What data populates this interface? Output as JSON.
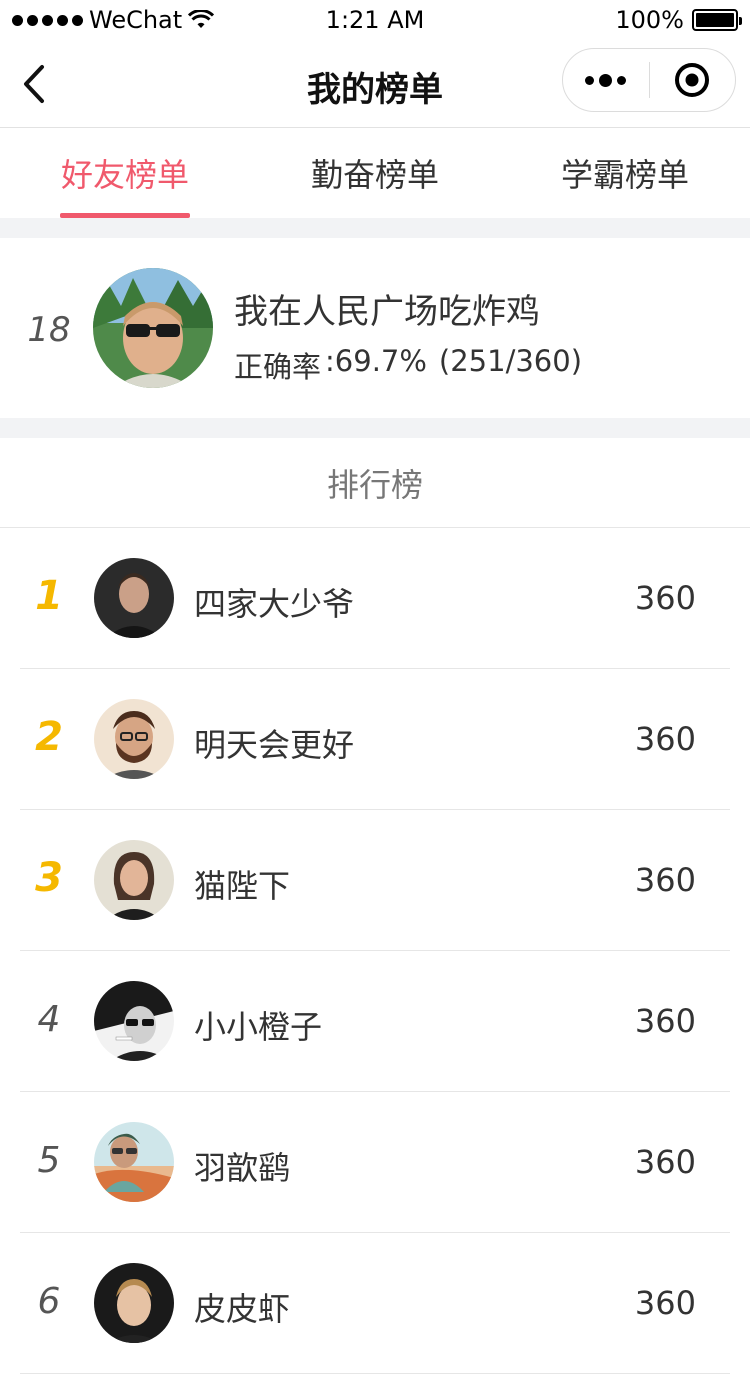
{
  "status_bar": {
    "carrier": "WeChat",
    "time": "1:21 AM",
    "battery": "100%",
    "battery_level": 1.0
  },
  "nav": {
    "title": "我的榜单"
  },
  "tabs": [
    {
      "label": "好友榜单",
      "active": true
    },
    {
      "label": "勤奋榜单",
      "active": false
    },
    {
      "label": "学霸榜单",
      "active": false
    }
  ],
  "my_card": {
    "rank": "18",
    "name": "我在人民广场吃炸鸡",
    "accuracy_label": "正确率",
    "accuracy_value": ":69.7%",
    "accuracy_ratio": "(251/360)"
  },
  "board": {
    "header": "排行榜",
    "rows": [
      {
        "rank": "1",
        "name": "四家大少爷",
        "score": "360"
      },
      {
        "rank": "2",
        "name": "明天会更好",
        "score": "360"
      },
      {
        "rank": "3",
        "name": "猫陛下",
        "score": "360"
      },
      {
        "rank": "4",
        "name": "小小橙子",
        "score": "360"
      },
      {
        "rank": "5",
        "name": "羽歆鹞",
        "score": "360"
      },
      {
        "rank": "6",
        "name": "皮皮虾",
        "score": "360"
      }
    ]
  },
  "colors": {
    "accent": "#f0596c",
    "gold_rank": "#f5b800",
    "background_band": "#f2f3f5"
  },
  "icons": {
    "back": "chevron-left-icon",
    "more": "more-dots-icon",
    "close": "target-circle-icon",
    "wifi": "wifi-icon",
    "battery": "battery-icon"
  }
}
